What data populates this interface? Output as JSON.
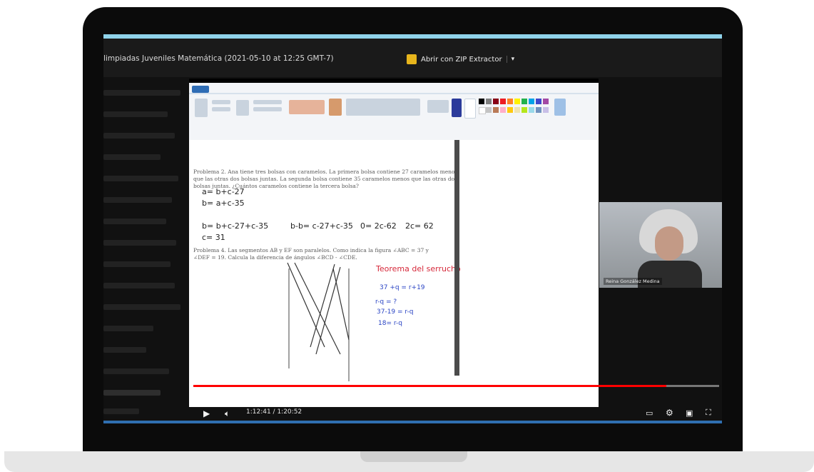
{
  "window": {
    "title": "limpiadas Juveniles Matemática (2021-05-10 at 12:25 GMT-7)",
    "zip_button": "Abrir con ZIP Extractor",
    "zip_dropdown": "▾"
  },
  "whiteboard": {
    "problem2": {
      "line1": "Problema 2. Ana tiene tres bolsas con caramelos. La primera bolsa contiene 27 caramelos menos",
      "line2": "que las otras dos bolsas juntas. La segunda bolsa contiene 35 caramelos menos que las otras dos",
      "line3": "bolsas juntas. ¿Cuántos caramelos contiene la tercera bolsa?"
    },
    "eq1": "a= b+c-27",
    "eq2": "b= a+c-35",
    "eq3": "b= b+c-27+c-35",
    "eq4": "b-b= c-27+c-35",
    "eq5": "0= 2c-62",
    "eq6": "2c= 62",
    "eq7": "c= 31",
    "problem4": {
      "line1": "Problema 4. Las segmentos AB y EF son paralelos. Como indica la figura ∠ABC = 37 y",
      "line2": "∠DEF = 19. Calcula la diferencia de ángulos ∠BCD - ∠CDE."
    },
    "theorem": "Teorema del serrucho",
    "eq8": "37 +q = r+19",
    "eq9": "r-q = ?",
    "eq10": "37-19 = r-q",
    "eq11": "18= r-q"
  },
  "player": {
    "time": "1:12:41 / 1:20:52",
    "progress": 0.9,
    "icons": [
      "play-icon",
      "volume-icon",
      "subtitles-icon",
      "settings-icon",
      "miniplayer-icon",
      "fullscreen-icon"
    ]
  },
  "webcam": {
    "name": "Reina González Medina"
  }
}
